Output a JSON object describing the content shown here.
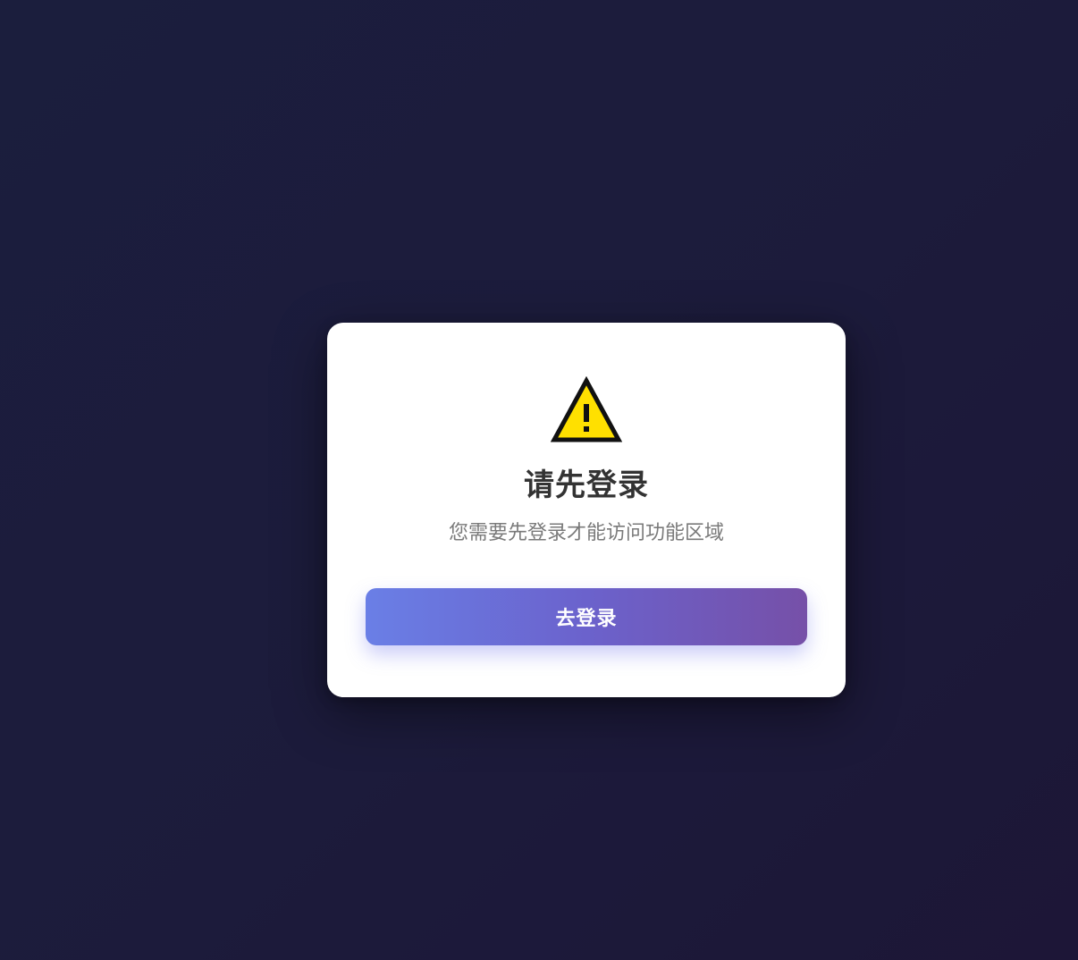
{
  "dialog": {
    "icon": "warning-icon",
    "title": "请先登录",
    "message": "您需要先登录才能访问功能区域",
    "login_button_label": "去登录"
  },
  "colors": {
    "background": "#201f42",
    "card": "#ffffff",
    "title": "#333333",
    "message": "#7a7a7a",
    "button_gradient_start": "#6a7fe6",
    "button_gradient_end": "#7650a8",
    "warning_fill": "#ffe000"
  }
}
